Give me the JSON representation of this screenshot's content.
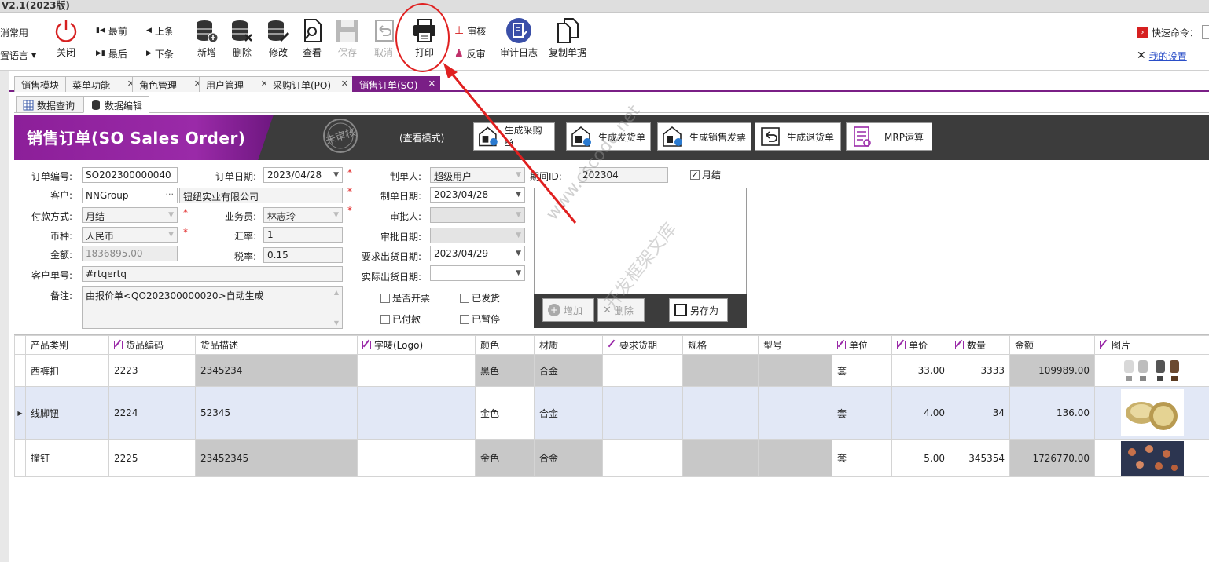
{
  "app": {
    "title": "V2.1(2023版)"
  },
  "toolbar": {
    "cancel_common": "消常用",
    "language": "置语言",
    "close": "关闭",
    "first": "最前",
    "last": "最后",
    "prev": "上条",
    "next": "下条",
    "add": "新增",
    "delete": "删除",
    "modify": "修改",
    "view": "查看",
    "save": "保存",
    "undo": "取消",
    "print": "打印",
    "approve": "审核",
    "unapprove": "反审",
    "audit_log": "审计日志",
    "copy": "复制单据",
    "quick_cmd": "快速命令：",
    "my_settings": "我的设置"
  },
  "tabs": [
    {
      "label": "销售模块"
    },
    {
      "label": "菜单功能"
    },
    {
      "label": "角色管理"
    },
    {
      "label": "用户管理"
    },
    {
      "label": "采购订单(PO)"
    },
    {
      "label": "销售订单(SO)"
    }
  ],
  "subtabs": {
    "query": "数据查询",
    "edit": "数据编辑"
  },
  "banner": {
    "title": "销售订单(SO Sales Order)",
    "stamp": "未审核",
    "mode": "(查看模式)",
    "buttons": [
      "生成采购单",
      "生成发货单",
      "生成销售发票",
      "生成退货单",
      "MRP运算"
    ]
  },
  "form": {
    "order_no_label": "订单编号:",
    "order_no": "SO202300000040",
    "customer_label": "客户:",
    "customer_code": "NNGroup",
    "customer_name": "钮纽实业有限公司",
    "payment_label": "付款方式:",
    "payment": "月结",
    "currency_label": "币种:",
    "currency": "人民币",
    "amount_label": "金额:",
    "amount": "1836895.00",
    "cust_order_label": "客户单号:",
    "cust_order": "#rtqertq",
    "remark_label": "备注:",
    "remark": "由报价单<QO202300000020>自动生成",
    "order_date_label": "订单日期:",
    "order_date": "2023/04/28",
    "salesman_label": "业务员:",
    "salesman": "林志玲",
    "rate_label": "汇率:",
    "rate": "1",
    "tax_label": "税率:",
    "tax": "0.15",
    "creator_label": "制单人:",
    "creator": "超级用户",
    "create_date_label": "制单日期:",
    "create_date": "2023/04/28",
    "approver_label": "审批人:",
    "approver": "",
    "approve_date_label": "审批日期:",
    "approve_date": "",
    "req_ship_label": "要求出货日期:",
    "req_ship": "2023/04/29",
    "act_ship_label": "实际出货日期:",
    "act_ship": "",
    "period_label": "期间ID:",
    "period": "202304",
    "monthly_label": "月结",
    "monthly_checked": true,
    "invoiced_label": "是否开票",
    "shipped_label": "已发货",
    "paid_label": "已付款",
    "paused_label": "已暂停"
  },
  "image_panel": {
    "add": "增加",
    "delete": "删除",
    "save_as": "另存为"
  },
  "watermark": [
    "csframework.com",
    "C/S框架网",
    "www.cscode.net",
    "开发框架文库"
  ],
  "grid": {
    "headers": [
      "产品类别",
      "货品编码",
      "货品描述",
      "字唛(Logo)",
      "颜色",
      "材质",
      "要求货期",
      "规格",
      "型号",
      "单位",
      "单价",
      "数量",
      "金额",
      "图片"
    ],
    "rows": [
      {
        "category": "西裤扣",
        "code": "2223",
        "desc": "2345234",
        "logo": "",
        "color": "黑色",
        "material": "合金",
        "due": "",
        "spec": "",
        "model": "",
        "unit": "套",
        "price": "33.00",
        "qty": "3333",
        "amount": "109989.00"
      },
      {
        "category": "线脚钮",
        "code": "2224",
        "desc": "52345",
        "logo": "",
        "color": "金色",
        "material": "合金",
        "due": "",
        "spec": "",
        "model": "",
        "unit": "套",
        "price": "4.00",
        "qty": "34",
        "amount": "136.00"
      },
      {
        "category": "撞钉",
        "code": "2225",
        "desc": "23452345",
        "logo": "",
        "color": "金色",
        "material": "合金",
        "due": "",
        "spec": "",
        "model": "",
        "unit": "套",
        "price": "5.00",
        "qty": "345354",
        "amount": "1726770.00"
      }
    ]
  },
  "colors": {
    "accent": "#7a1f86",
    "banner": "#3c3c3c",
    "annotation": "#e02020"
  }
}
